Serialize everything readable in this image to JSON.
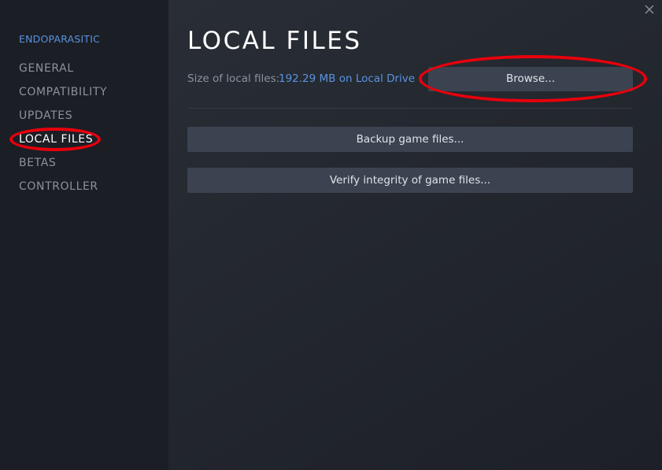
{
  "sidebar": {
    "game_title": "ENDOPARASITIC",
    "items": [
      {
        "label": "GENERAL",
        "active": false
      },
      {
        "label": "COMPATIBILITY",
        "active": false
      },
      {
        "label": "UPDATES",
        "active": false
      },
      {
        "label": "LOCAL FILES",
        "active": true
      },
      {
        "label": "BETAS",
        "active": false
      },
      {
        "label": "CONTROLLER",
        "active": false
      }
    ]
  },
  "main": {
    "title": "LOCAL FILES",
    "size_label": "Size of local files:",
    "size_value": "192.29 MB on Local Drive (",
    "browse_label": "Browse...",
    "backup_label": "Backup game files...",
    "verify_label": "Verify integrity of game files..."
  },
  "icons": {
    "close": "close-icon"
  },
  "colors": {
    "accent": "#5a93e0",
    "highlight": "#e8000c",
    "button": "#3c4350",
    "sidebar": "#1b1e24"
  }
}
